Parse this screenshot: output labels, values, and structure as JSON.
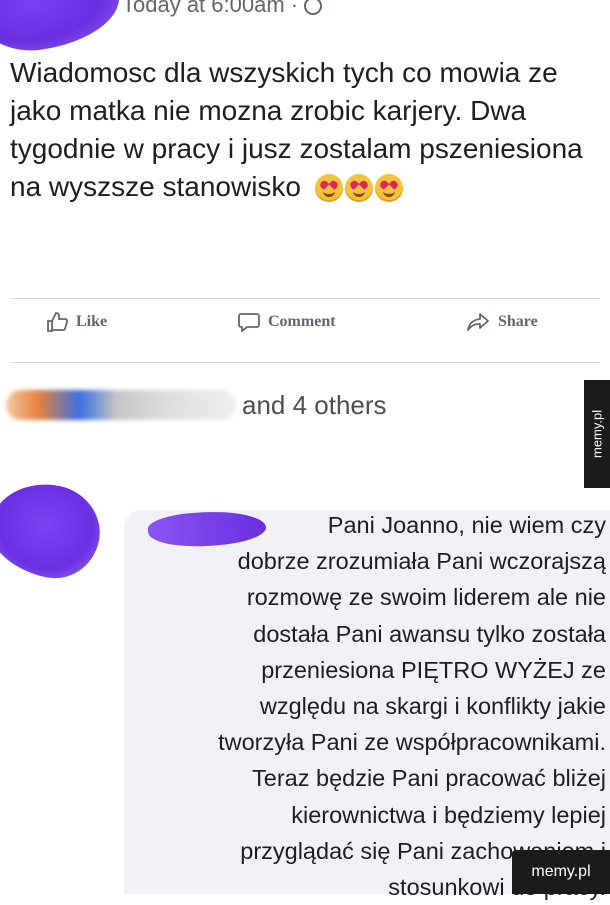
{
  "post": {
    "timestamp": "Today at 6:00am ·",
    "text": "Wiadomosc dla wszyskich tych co mowia ze jako matka nie mozna zrobic karjery. Dwa tygodnie w pracy i jusz zostalam pszeniesiona na wyszsze stanowisko",
    "emojis": [
      "heart-eyes-emoji",
      "heart-eyes-emoji",
      "heart-eyes-emoji"
    ]
  },
  "actions": {
    "like": "Like",
    "comment": "Comment",
    "share": "Share"
  },
  "reactions": {
    "text": "and 4 others"
  },
  "comment": {
    "lines": [
      "Pani Joanno, nie wiem czy",
      "dobrze zrozumiała Pani wczorajszą",
      "rozmowę ze swoim liderem ale nie",
      "dostała Pani awansu tylko została",
      "przeniesiona PIĘTRO WYŻEJ ze",
      "względu na skargi i konflikty jakie",
      "tworzyła Pani ze współpracownikami.",
      "Teraz będzie Pani pracować bliżej",
      "kierownictwa i będziemy lepiej",
      "przyglądać się Pani zachowaniom i",
      "stosunkowi do pracy."
    ]
  },
  "watermark": {
    "side": "memy.pl",
    "bottom": "memy.pl"
  }
}
